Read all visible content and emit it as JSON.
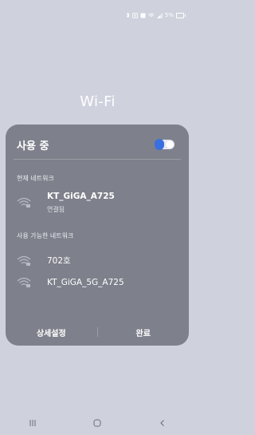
{
  "status_bar": {
    "battery_text": "5%",
    "icons": [
      "bluetooth-icon",
      "nfc-icon",
      "data-saver-icon",
      "wifi-icon",
      "signal-icon",
      "battery-icon"
    ]
  },
  "page": {
    "title": "Wi-Fi"
  },
  "panel": {
    "title": "사용 중",
    "toggle_on": true,
    "accent_color": "#3a6fe0",
    "current_section_label": "현재 네트워크",
    "current_network": {
      "name": "KT_GiGA_A725",
      "status": "연결됨"
    },
    "available_section_label": "사용 가능한 네트워크",
    "available_networks": [
      {
        "name": "702호"
      },
      {
        "name": "KT_GiGA_5G_A725"
      }
    ],
    "buttons": {
      "advanced": "상세설정",
      "done": "완료"
    }
  },
  "navbar": {
    "icons": [
      "recent-apps-icon",
      "home-icon",
      "back-icon"
    ]
  }
}
